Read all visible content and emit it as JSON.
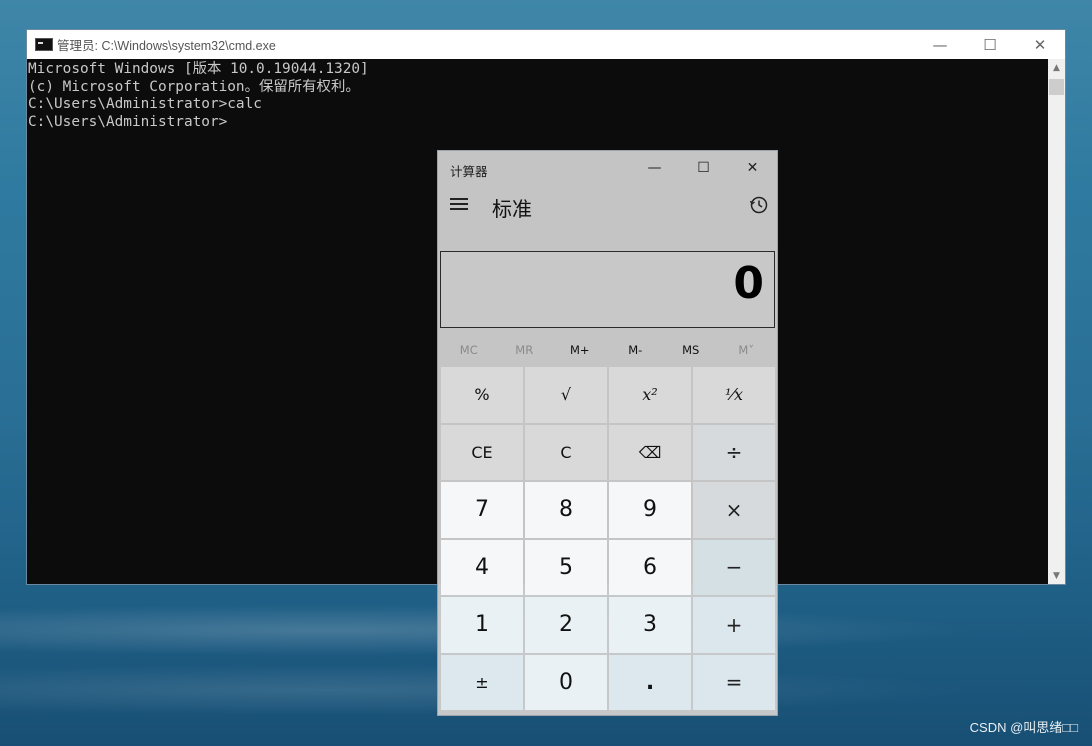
{
  "cmd": {
    "title": "管理员: C:\\Windows\\system32\\cmd.exe",
    "lines": [
      "Microsoft Windows [版本 10.0.19044.1320]",
      "(c) Microsoft Corporation。保留所有权利。",
      "",
      "C:\\Users\\Administrator>calc",
      "",
      "C:\\Users\\Administrator>"
    ],
    "buttons": {
      "minimize": "—",
      "maximize": "☐",
      "close": "✕"
    }
  },
  "calc": {
    "title": "计算器",
    "mode": "标准",
    "display": "0",
    "buttons": {
      "minimize": "—",
      "maximize": "☐",
      "close": "✕"
    },
    "memory": [
      {
        "label": "MC",
        "enabled": false
      },
      {
        "label": "MR",
        "enabled": false
      },
      {
        "label": "M+",
        "enabled": true
      },
      {
        "label": "M-",
        "enabled": true
      },
      {
        "label": "MS",
        "enabled": true
      },
      {
        "label": "M˅",
        "enabled": false
      }
    ],
    "keys": {
      "percent": "%",
      "sqrt": "√",
      "square": "x²",
      "reciprocal": "⅟x",
      "ce": "CE",
      "c": "C",
      "backspace": "⌫",
      "divide": "÷",
      "seven": "7",
      "eight": "8",
      "nine": "9",
      "multiply": "×",
      "four": "4",
      "five": "5",
      "six": "6",
      "minus": "−",
      "one": "1",
      "two": "2",
      "three": "3",
      "plus": "+",
      "negate": "±",
      "zero": "0",
      "decimal": ".",
      "equals": "="
    }
  },
  "watermark": "CSDN @叫思绪□□"
}
